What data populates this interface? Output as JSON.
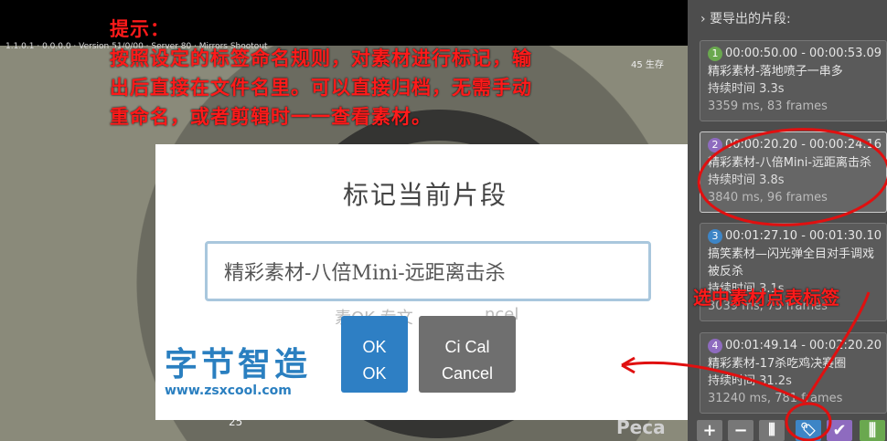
{
  "video": {
    "hud_top_left": "1.1.0.1 · 0.0.0.0 · Version 51/0/00 · Server 80 · Mirrors Shootout",
    "hud_top_right": "45 生存",
    "hud_bottom": "25",
    "hud_peca": "Peca"
  },
  "annotation": {
    "line1": "提示：",
    "line2": "按照设定的标签命名规则，对素材进行标记，输",
    "line3": "出后直接在文件名里。可以直接归档，无需手动",
    "line4": "重命名，或者剪辑时一一查看素材。",
    "side_label": "选中素材点表标签"
  },
  "dialog": {
    "title": "标记当前片段",
    "input_value": "精彩素材-八倍Mini-远距离击杀",
    "ghost_text_1": "素OK 专文",
    "ghost_text_2": "ncel",
    "ok_line1": "OK",
    "ok_line2": "OK",
    "cancel_line1": "Ci  Cal",
    "cancel_line2": "Cancel"
  },
  "logo": {
    "name": "字节智造",
    "url": "www.zsxcool.com"
  },
  "panel": {
    "title": "要导出的片段:",
    "clips": [
      {
        "index": "1",
        "color": "#6aa84f",
        "range": "00:00:50.00 - 00:00:53.09",
        "name": "精彩素材-落地喷子一串多",
        "duration": "持续时间 3.3s",
        "frames": "3359 ms, 83 frames"
      },
      {
        "index": "2",
        "color": "#8e6bbf",
        "range": "00:00:20.20 - 00:00:24.16",
        "name": "精彩素材-八倍Mini-远距离击杀",
        "duration": "持续时间 3.8s",
        "frames": "3840 ms, 96 frames"
      },
      {
        "index": "3",
        "color": "#3d85c6",
        "range": "00:01:27.10 - 00:01:30.10",
        "name": "搞笑素材—闪光弹全目对手调戏被反杀",
        "duration": "持续时间 3.1s",
        "frames": "3039 ms, 75 frames"
      },
      {
        "index": "4",
        "color": "#8e6bbf",
        "range": "00:01:49.14 - 00:02:20.20",
        "name": "精彩素材-17杀吃鸡决赛圈",
        "duration": "持续时间 31.2s",
        "frames": "31240 ms, 781 frames"
      }
    ],
    "toolbar": [
      "+",
      "−",
      "⫴",
      "🏷",
      "✔",
      "⫼"
    ]
  }
}
